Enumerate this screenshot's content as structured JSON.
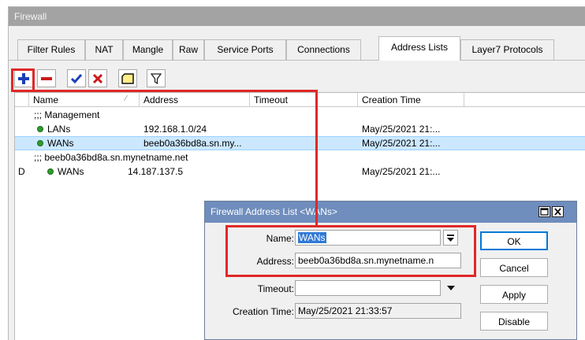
{
  "window": {
    "title": "Firewall"
  },
  "tabs": [
    {
      "label": "Filter Rules"
    },
    {
      "label": "NAT"
    },
    {
      "label": "Mangle"
    },
    {
      "label": "Raw"
    },
    {
      "label": "Service Ports"
    },
    {
      "label": "Connections"
    },
    {
      "label": "Address Lists"
    },
    {
      "label": "Layer7 Protocols"
    }
  ],
  "active_tab": "Address Lists",
  "toolbar": {
    "add_icon": "plus-icon",
    "remove_icon": "minus-icon",
    "enable_icon": "check-icon",
    "disable_icon": "x-icon",
    "comment_icon": "comment-icon",
    "filter_icon": "filter-icon"
  },
  "table": {
    "columns": {
      "name": "Name",
      "address": "Address",
      "timeout": "Timeout",
      "creation_time": "Creation Time"
    },
    "rows": [
      {
        "kind": "comment",
        "text": ";;; Management"
      },
      {
        "kind": "entry",
        "flag": "",
        "name": "LANs",
        "address": "192.168.1.0/24",
        "timeout": "",
        "creation_time": "May/25/2021 21:..."
      },
      {
        "kind": "entry",
        "flag": "",
        "name": "WANs",
        "address": "beeb0a36bd8a.sn.my...",
        "timeout": "",
        "creation_time": "May/25/2021 21:...",
        "selected": true
      },
      {
        "kind": "comment",
        "text": ";;; beeb0a36bd8a.sn.mynetname.net"
      },
      {
        "kind": "entry",
        "flag": "D",
        "name": "WANs",
        "address": "14.187.137.5",
        "timeout": "",
        "creation_time": "May/25/2021 21:..."
      }
    ]
  },
  "dialog": {
    "title": "Firewall Address List <WANs>",
    "name_label": "Name:",
    "name_value": "WANs",
    "address_label": "Address:",
    "address_value": "beeb0a36bd8a.sn.mynetname.n",
    "timeout_label": "Timeout:",
    "timeout_value": "",
    "creation_label": "Creation Time:",
    "creation_value": "May/25/2021 21:33:57",
    "buttons": {
      "ok": "OK",
      "cancel": "Cancel",
      "apply": "Apply",
      "disable": "Disable"
    }
  },
  "colors": {
    "highlight": "#e02828",
    "dialog_title": "#6f8dbd",
    "selection": "#cce8ff",
    "status_green": "#2e9b2e"
  }
}
